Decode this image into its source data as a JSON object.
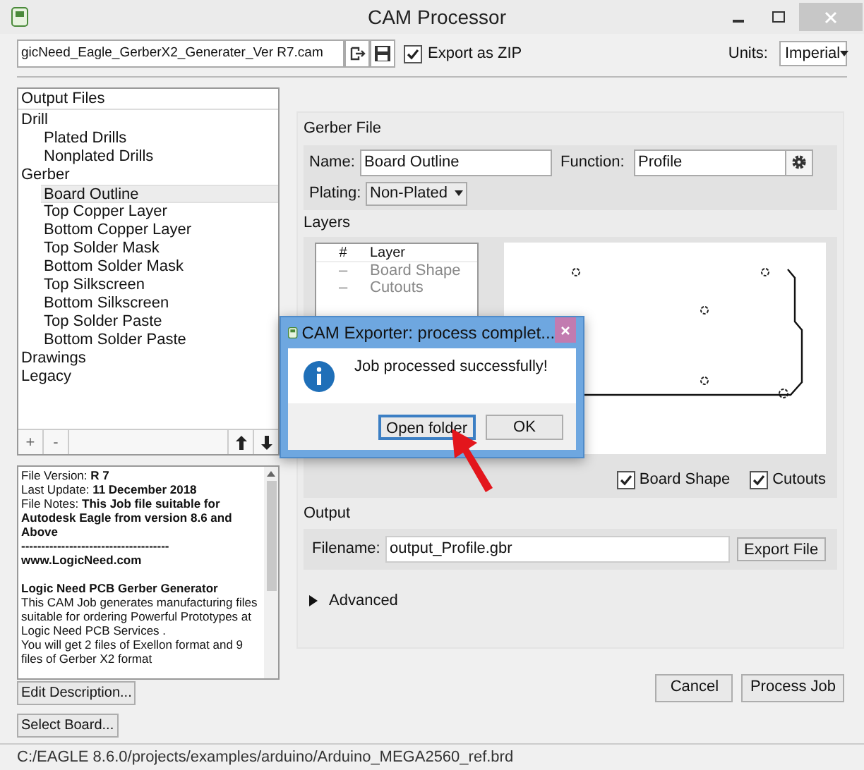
{
  "window": {
    "title": "CAM Processor"
  },
  "toolbar": {
    "job_file": "gicNeed_Eagle_GerberX2_Generater_Ver R7.cam",
    "export_zip": {
      "label": "Export as ZIP",
      "checked": true
    },
    "units_label": "Units:",
    "units_value": "Imperial"
  },
  "output_files": {
    "header": "Output Files",
    "items": [
      {
        "label": "Drill",
        "selected": false,
        "children": [
          {
            "label": "Plated Drills",
            "selected": false
          },
          {
            "label": "Nonplated Drills",
            "selected": false
          }
        ]
      },
      {
        "label": "Gerber",
        "selected": false,
        "children": [
          {
            "label": "Board Outline",
            "selected": true
          },
          {
            "label": "Top Copper Layer",
            "selected": false
          },
          {
            "label": "Bottom Copper Layer",
            "selected": false
          },
          {
            "label": "Top Solder Mask",
            "selected": false
          },
          {
            "label": "Bottom Solder Mask",
            "selected": false
          },
          {
            "label": "Top Silkscreen",
            "selected": false
          },
          {
            "label": "Bottom Silkscreen",
            "selected": false
          },
          {
            "label": "Top Solder Paste",
            "selected": false
          },
          {
            "label": "Bottom Solder Paste",
            "selected": false
          }
        ]
      },
      {
        "label": "Drawings",
        "selected": false
      },
      {
        "label": "Legacy",
        "selected": false
      }
    ],
    "add_button": "+",
    "remove_button": "-"
  },
  "description": [
    {
      "kind": "plain",
      "text": "File Version: **R 7**"
    },
    {
      "kind": "plain",
      "text": "Last Update: **11 December 2018**"
    },
    {
      "kind": "plain",
      "text": "File Notes: **This Job file suitable for Autodesk Eagle from version 8.6 and Above**"
    },
    {
      "kind": "bold",
      "text": "-------------------------------------"
    },
    {
      "kind": "bold",
      "text": "www.LogicNeed.com"
    },
    {
      "kind": "heading",
      "text": "Logic Need PCB Gerber Generator"
    },
    {
      "kind": "plain",
      "text": "This CAM Job generates manufacturing files suitable for ordering Powerful Prototypes at Logic Need PCB Services ."
    },
    {
      "kind": "plain",
      "text": "You will get 2 files of Exellon format and 9 files of Gerber X2 format"
    }
  ],
  "edit_description_button": "Edit Description...",
  "select_board_button": "Select Board...",
  "gerber_file": {
    "title": "Gerber File",
    "name_label": "Name:",
    "name_value": "Board Outline",
    "function_label": "Function:",
    "function_value": "Profile",
    "plating_label": "Plating:",
    "plating_value": "Non-Plated"
  },
  "layers": {
    "title": "Layers",
    "columns": [
      "#",
      "Layer"
    ],
    "rows": [
      {
        "number": "–",
        "name": "Board Shape"
      },
      {
        "number": "–",
        "name": "Cutouts"
      }
    ],
    "toggles": [
      {
        "label": "Board Shape",
        "checked": true
      },
      {
        "label": "Cutouts",
        "checked": true
      }
    ]
  },
  "output": {
    "title": "Output",
    "filename_label": "Filename:",
    "filename_value": "output_Profile.gbr",
    "export_button": "Export File"
  },
  "advanced": {
    "label": "Advanced",
    "expanded": false
  },
  "buttons": [
    "Cancel",
    "Process Job"
  ],
  "status_bar": "C:/EAGLE 8.6.0/projects/examples/arduino/Arduino_MEGA2560_ref.brd",
  "dialog": {
    "title": "CAM Exporter: process complet...",
    "message": "Job processed successfully!",
    "buttons": [
      {
        "label": "Open folder",
        "selected": true
      },
      {
        "label": "OK",
        "selected": false
      }
    ]
  }
}
